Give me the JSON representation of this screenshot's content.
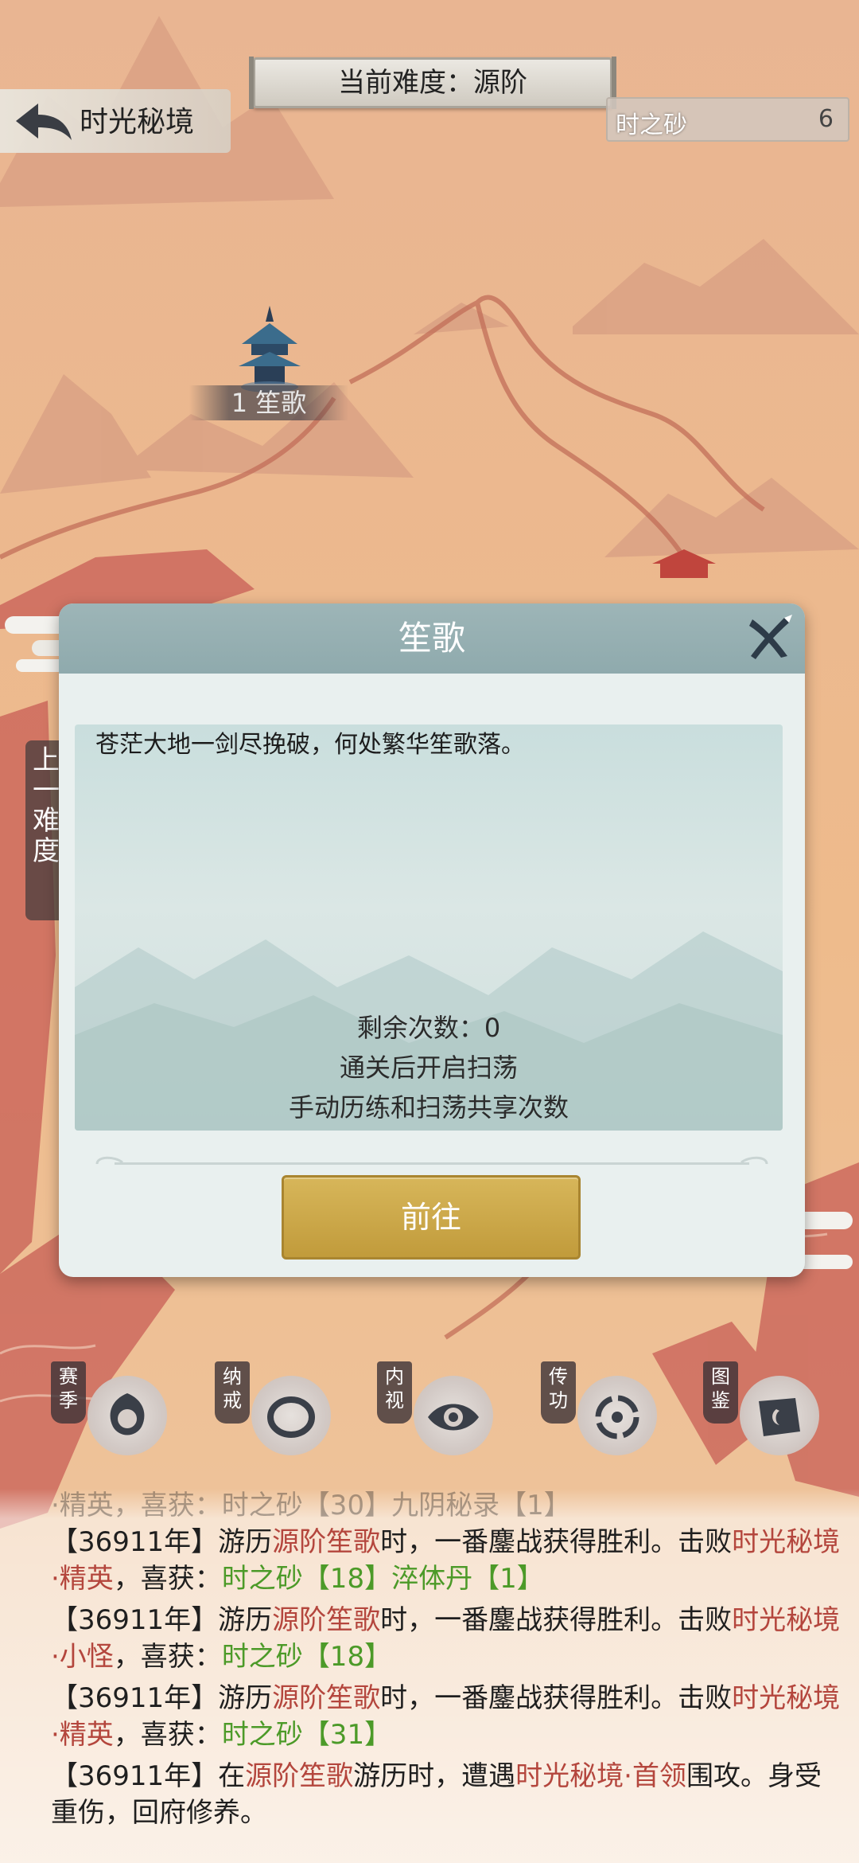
{
  "header": {
    "back_label": "时光秘境",
    "difficulty_label": "当前难度：源阶",
    "currency": {
      "name": "时之砂",
      "count": "6"
    }
  },
  "map": {
    "node_label": "1 笙歌",
    "side_tab": [
      "上",
      "一",
      "难",
      "度"
    ]
  },
  "dialog": {
    "title": "笙歌",
    "description": "苍茫大地一剑尽挽破，何处繁华笙歌落。",
    "remaining": "剩余次数：0",
    "sweep_hint": "通关后开启扫荡",
    "share_hint": "手动历练和扫荡共享次数",
    "go_button": "前往"
  },
  "features": [
    {
      "label": "赛季",
      "icon": "season-icon"
    },
    {
      "label": "纳戒",
      "icon": "ring-icon"
    },
    {
      "label": "内视",
      "icon": "eye-icon"
    },
    {
      "label": "传功",
      "icon": "transfer-icon"
    },
    {
      "label": "图鉴",
      "icon": "book-icon"
    }
  ],
  "log": {
    "partial_line": "·精英，喜获：时之砂【30】九阴秘录【1】",
    "entries": [
      {
        "l1_a": "【36911年】游历",
        "l1_b": "源阶笙歌",
        "l1_c": "时，一番鏖战获得胜利。击败",
        "l1_d": "时光秘境",
        "l2_a": "·精英",
        "l2_b": "，喜获：",
        "l2_c": "时之砂【18】淬体丹【1】"
      },
      {
        "l1_a": "【36911年】游历",
        "l1_b": "源阶笙歌",
        "l1_c": "时，一番鏖战获得胜利。击败",
        "l1_d": "时光秘境",
        "l2_a": "·小怪",
        "l2_b": "，喜获：",
        "l2_c": "时之砂【18】"
      },
      {
        "l1_a": "【36911年】游历",
        "l1_b": "源阶笙歌",
        "l1_c": "时，一番鏖战获得胜利。击败",
        "l1_d": "时光秘境",
        "l2_a": "·精英",
        "l2_b": "，喜获：",
        "l2_c": "时之砂【31】"
      }
    ],
    "last": {
      "a": "【36911年】在",
      "b": "源阶笙歌",
      "c": "游历时，遭遇",
      "d": "时光秘境·首领",
      "e": "围攻。身受",
      "f": "重伤，回府修养。"
    }
  },
  "colors": {
    "accent_red": "#b4463d",
    "accent_green": "#4c9a28",
    "button_gold": "#c8a245",
    "dialog_header": "#96b0b2"
  }
}
